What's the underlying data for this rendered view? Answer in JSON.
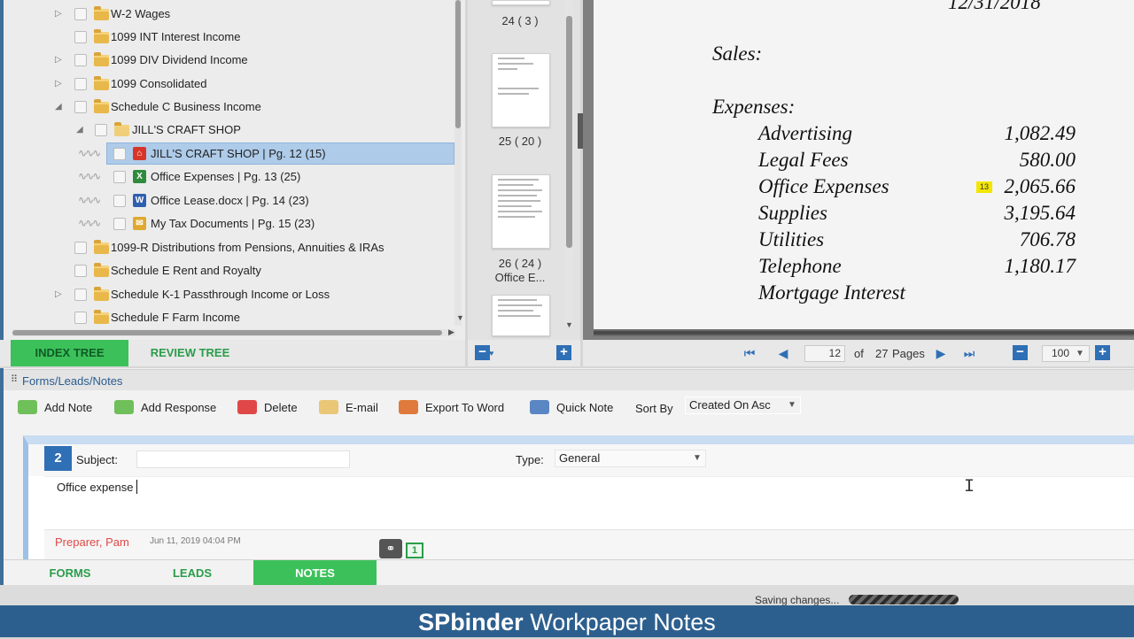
{
  "tree": {
    "items": [
      {
        "label": "W-2 Wages"
      },
      {
        "label": "1099 INT Interest Income"
      },
      {
        "label": "1099 DIV Dividend Income"
      },
      {
        "label": "1099 Consolidated"
      },
      {
        "label": "Schedule C Business Income"
      },
      {
        "label": "JILL'S CRAFT SHOP"
      },
      {
        "label": "JILL'S CRAFT SHOP  | Pg. 12 (15)"
      },
      {
        "label": "Office Expenses  | Pg. 13 (25)"
      },
      {
        "label": "Office Lease.docx  | Pg. 14 (23)"
      },
      {
        "label": "My Tax Documents  | Pg. 15 (23)"
      },
      {
        "label": "1099-R  Distributions from Pensions, Annuities & IRAs"
      },
      {
        "label": "Schedule E  Rent and Royalty"
      },
      {
        "label": "Schedule K-1 Passthrough Income or Loss"
      },
      {
        "label": "Schedule F Farm Income"
      }
    ],
    "tabs": {
      "index": "INDEX TREE",
      "review": "REVIEW TREE"
    }
  },
  "thumbs": {
    "captions": [
      "24 ( 3 )",
      "25 ( 20 )",
      "26 ( 24 )",
      "Office E..."
    ]
  },
  "document": {
    "date": "12/31/2018",
    "sales": "Sales:",
    "expenses": "Expenses:",
    "rows": [
      {
        "label": "Advertising",
        "amount": "1,082.49"
      },
      {
        "label": "Legal Fees",
        "amount": "580.00"
      },
      {
        "label": "Office Expenses",
        "amount": "2,065.66",
        "note_badge": "13"
      },
      {
        "label": "Supplies",
        "amount": "3,195.64"
      },
      {
        "label": "Utilities",
        "amount": "706.78"
      },
      {
        "label": "Telephone",
        "amount": "1,180.17"
      },
      {
        "label": "Mortgage Interest",
        "amount": ""
      }
    ]
  },
  "pager": {
    "current": "12",
    "of": "of",
    "total": "27",
    "pages_label": "Pages",
    "zoom": "100"
  },
  "forms": {
    "header": "Forms/Leads/Notes",
    "toolbar": {
      "add_note": "Add Note",
      "add_response": "Add Response",
      "delete": "Delete",
      "email": "E-mail",
      "export": "Export To Word",
      "quick_note": "Quick Note",
      "sort_label": "Sort By",
      "sort_value": "Created On Asc"
    },
    "note": {
      "number": "2",
      "subject_label": "Subject:",
      "subject_value": "",
      "type_label": "Type:",
      "type_value": "General",
      "body": "Office expense",
      "author": "Preparer, Pam",
      "timestamp": "Jun 11, 2019 04:04 PM",
      "attach_count": "1"
    },
    "tabs": {
      "forms": "FORMS",
      "leads": "LEADS",
      "notes": "NOTES"
    },
    "status": "Saving changes..."
  },
  "banner": {
    "brand": "SPbinder",
    "title": "Workpaper Notes"
  },
  "colors": {
    "accent_green": "#2a9d4a",
    "notes_tab": "#3cc15a",
    "blue": "#2f6fb5",
    "banner": "#2d5f8e",
    "author_red": "#e04848"
  }
}
